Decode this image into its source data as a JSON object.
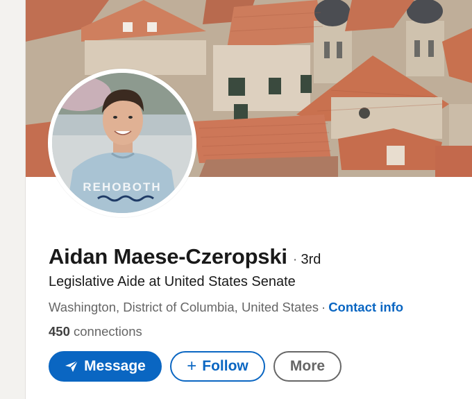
{
  "profile": {
    "name": "Aidan Maese-Czeropski",
    "degree_separator": "·",
    "degree": "3rd",
    "headline": "Legislative Aide at United States Senate",
    "location": "Washington, District of Columbia, United States",
    "location_separator": "·",
    "contact_info_label": "Contact info",
    "connections_count": "450",
    "connections_label": "connections",
    "shirt_text": "REHOBOTH"
  },
  "actions": {
    "message_label": "Message",
    "message_icon": "paper-plane-icon",
    "follow_plus": "+",
    "follow_label": "Follow",
    "more_label": "More"
  },
  "colors": {
    "accent": "#0a66c2",
    "text_primary": "#191919",
    "text_secondary": "#666666",
    "roof": "#c8704f"
  }
}
